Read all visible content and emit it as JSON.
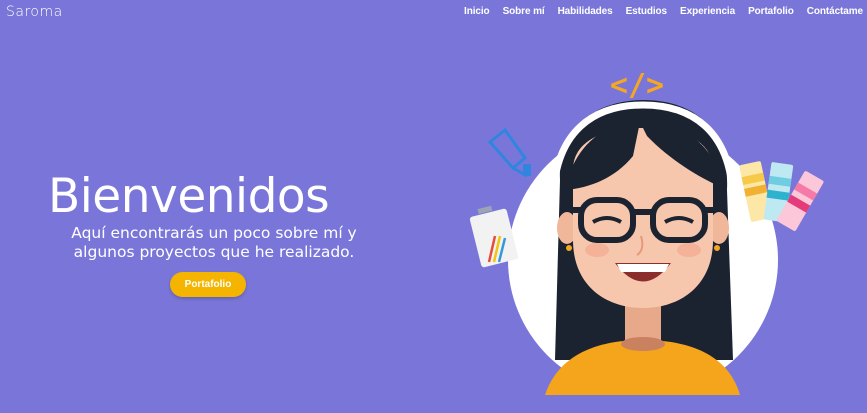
{
  "header": {
    "logo": "Saroma",
    "nav": [
      {
        "label": "Inicio"
      },
      {
        "label": "Sobre mí"
      },
      {
        "label": "Habilidades"
      },
      {
        "label": "Estudios"
      },
      {
        "label": "Experiencia"
      },
      {
        "label": "Portafolio"
      },
      {
        "label": "Contáctame"
      }
    ]
  },
  "hero": {
    "title": "Bienvenidos",
    "subtitle_line1": "Aquí encontrarás un poco sobre mí y",
    "subtitle_line2": "algunos proyectos que he realizado.",
    "cta_label": "Portafolio",
    "code_tag": "</>"
  },
  "colors": {
    "background": "#7a76d9",
    "accent": "#f5b400",
    "text": "#ffffff"
  }
}
